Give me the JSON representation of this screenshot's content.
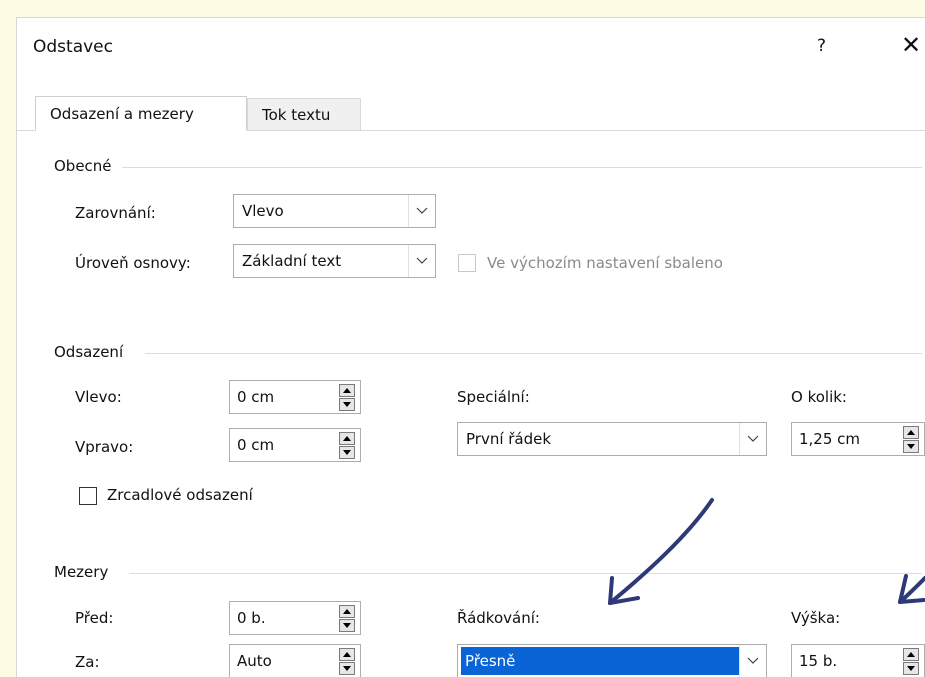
{
  "dialog": {
    "title": "Odstavec",
    "help_label": "?",
    "close_label": "✕"
  },
  "tabs": [
    {
      "label": "Odsazení a mezery",
      "active": true
    },
    {
      "label": "Tok textu",
      "active": false
    }
  ],
  "general": {
    "group_label": "Obecné",
    "alignment_label": "Zarovnání:",
    "alignment_value": "Vlevo",
    "outline_label": "Úroveň osnovy:",
    "outline_value": "Základní text",
    "collapsed_label": "Ve výchozím nastavení sbaleno"
  },
  "indentation": {
    "group_label": "Odsazení",
    "left_label": "Vlevo:",
    "left_value": "0 cm",
    "right_label": "Vpravo:",
    "right_value": "0 cm",
    "special_label": "Speciální:",
    "special_value": "První řádek",
    "by_label": "O kolik:",
    "by_value": "1,25 cm",
    "mirror_label": "Zrcadlové odsazení"
  },
  "spacing": {
    "group_label": "Mezery",
    "before_label": "Před:",
    "before_value": "0 b.",
    "after_label": "Za:",
    "after_value": "Auto",
    "line_spacing_label": "Řádkování:",
    "line_spacing_value": "Přesně",
    "height_label": "Výška:",
    "height_value": "15 b."
  },
  "colors": {
    "page_bg": "#fdfbe4",
    "selection": "#0a64d6",
    "annotation_arrow": "#2e3a78"
  }
}
